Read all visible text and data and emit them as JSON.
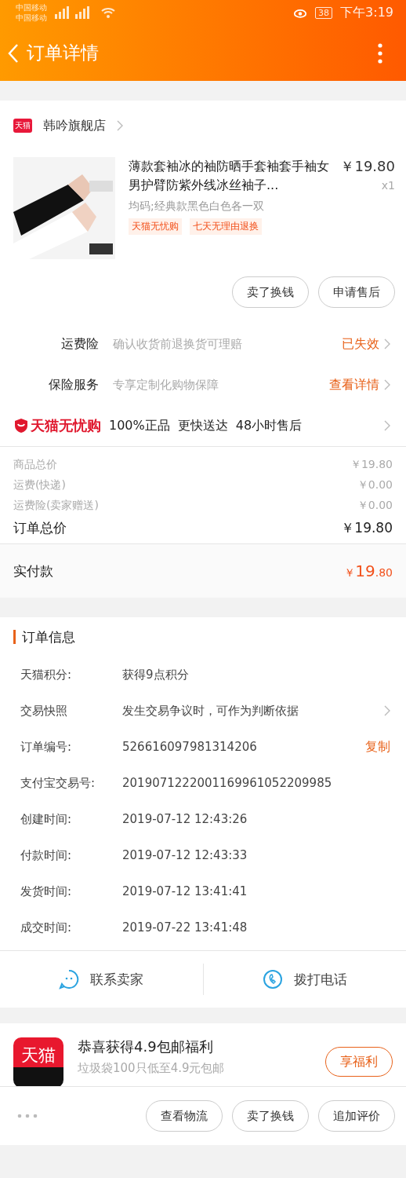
{
  "status_bar": {
    "carriers": [
      "中国移动",
      "中国移动"
    ],
    "battery": "38",
    "time": "下午3:19"
  },
  "header": {
    "title": "订单详情"
  },
  "store": {
    "badge": "天猫",
    "name": "韩吟旗舰店"
  },
  "product": {
    "title": "薄款套袖冰的袖防晒手套袖套手袖女男护臂防紫外线冰丝袖子...",
    "price": "￥19.80",
    "quantity": "x1",
    "sku": "均码;经典款黑色白色各一双",
    "tags": [
      "天猫无忧购",
      "七天无理由退换"
    ]
  },
  "product_actions": [
    "卖了换钱",
    "申请售后"
  ],
  "services": [
    {
      "label": "运费险",
      "description": "确认收货前退换货可理赔",
      "action": "已失效"
    },
    {
      "label": "保险服务",
      "description": "专享定制化购物保障",
      "action": "查看详情"
    }
  ],
  "guarantee": {
    "brand": "天猫无忧购",
    "points": [
      "100%正品",
      "更快送达",
      "48小时售后"
    ]
  },
  "price_rows": [
    {
      "label": "商品总价",
      "value": "￥19.80",
      "kind": "minor"
    },
    {
      "label": "运费(快递)",
      "value": "￥0.00",
      "kind": "minor"
    },
    {
      "label": "运费险(卖家赠送)",
      "value": "￥0.00",
      "kind": "minor"
    },
    {
      "label": "订单总价",
      "value": "￥19.80",
      "kind": "total"
    }
  ],
  "paid": {
    "label": "实付款",
    "currency": "￥",
    "integer": "19",
    "decimal": ".80"
  },
  "order_info": {
    "title": "订单信息",
    "rows": [
      {
        "label": "天猫积分:",
        "value": "获得9点积分",
        "kind": "plain"
      },
      {
        "label": "交易快照",
        "value": "发生交易争议时，可作为判断依据",
        "kind": "chevron"
      },
      {
        "label": "订单编号:",
        "value": "526616097981314206",
        "kind": "copy",
        "action": "复制"
      },
      {
        "label": "支付宝交易号:",
        "value": "2019071222001169961052209985",
        "kind": "plain"
      },
      {
        "label": "创建时间:",
        "value": "2019-07-12 12:43:26",
        "kind": "plain"
      },
      {
        "label": "付款时间:",
        "value": "2019-07-12 12:43:33",
        "kind": "plain"
      },
      {
        "label": "发货时间:",
        "value": "2019-07-12 13:41:41",
        "kind": "plain"
      },
      {
        "label": "成交时间:",
        "value": "2019-07-22 13:41:48",
        "kind": "plain"
      }
    ]
  },
  "contacts": [
    {
      "label": "联系卖家",
      "kind": "chat"
    },
    {
      "label": "拨打电话",
      "kind": "phone"
    }
  ],
  "promo": {
    "logo": "天猫",
    "title": "恭喜获得4.9包邮福利",
    "subtitle": "垃圾袋100只低至4.9元包邮",
    "button": "享福利"
  },
  "bottom_bar": {
    "buttons": [
      "查看物流",
      "卖了换钱",
      "追加评价"
    ]
  }
}
